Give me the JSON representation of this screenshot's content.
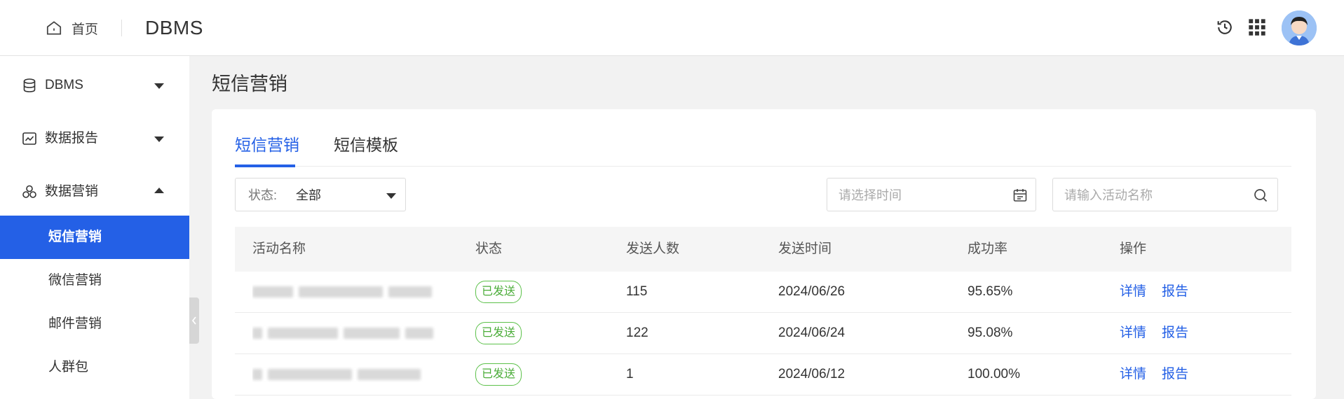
{
  "header": {
    "home_label": "首页",
    "app_title": "DBMS",
    "icons": [
      "history-icon",
      "apps-grid-icon"
    ]
  },
  "sidebar": {
    "groups": [
      {
        "label": "DBMS",
        "icon": "database-icon",
        "expanded": false
      },
      {
        "label": "数据报告",
        "icon": "chart-icon",
        "expanded": false
      },
      {
        "label": "数据营销",
        "icon": "marketing-icon",
        "expanded": true
      }
    ],
    "sub_items": [
      {
        "label": "短信营销",
        "active": true
      },
      {
        "label": "微信营销",
        "active": false
      },
      {
        "label": "邮件营销",
        "active": false
      },
      {
        "label": "人群包",
        "active": false
      }
    ]
  },
  "main": {
    "page_title": "短信营销",
    "tabs": [
      {
        "label": "短信营销",
        "active": true
      },
      {
        "label": "短信模板",
        "active": false
      }
    ],
    "filters": {
      "status_label": "状态:",
      "status_value": "全部",
      "time_placeholder": "请选择时间",
      "search_placeholder": "请输入活动名称"
    },
    "table": {
      "columns": [
        "活动名称",
        "状态",
        "发送人数",
        "发送时间",
        "成功率",
        "操作"
      ],
      "rows": [
        {
          "status": "已发送",
          "count": "115",
          "time": "2024/06/26",
          "rate": "95.65%",
          "detail": "详情",
          "report": "报告"
        },
        {
          "status": "已发送",
          "count": "122",
          "time": "2024/06/24",
          "rate": "95.08%",
          "detail": "详情",
          "report": "报告"
        },
        {
          "status": "已发送",
          "count": "1",
          "time": "2024/06/12",
          "rate": "100.00%",
          "detail": "详情",
          "report": "报告"
        }
      ]
    }
  },
  "colors": {
    "accent": "#2460e6",
    "success": "#4aac38"
  }
}
